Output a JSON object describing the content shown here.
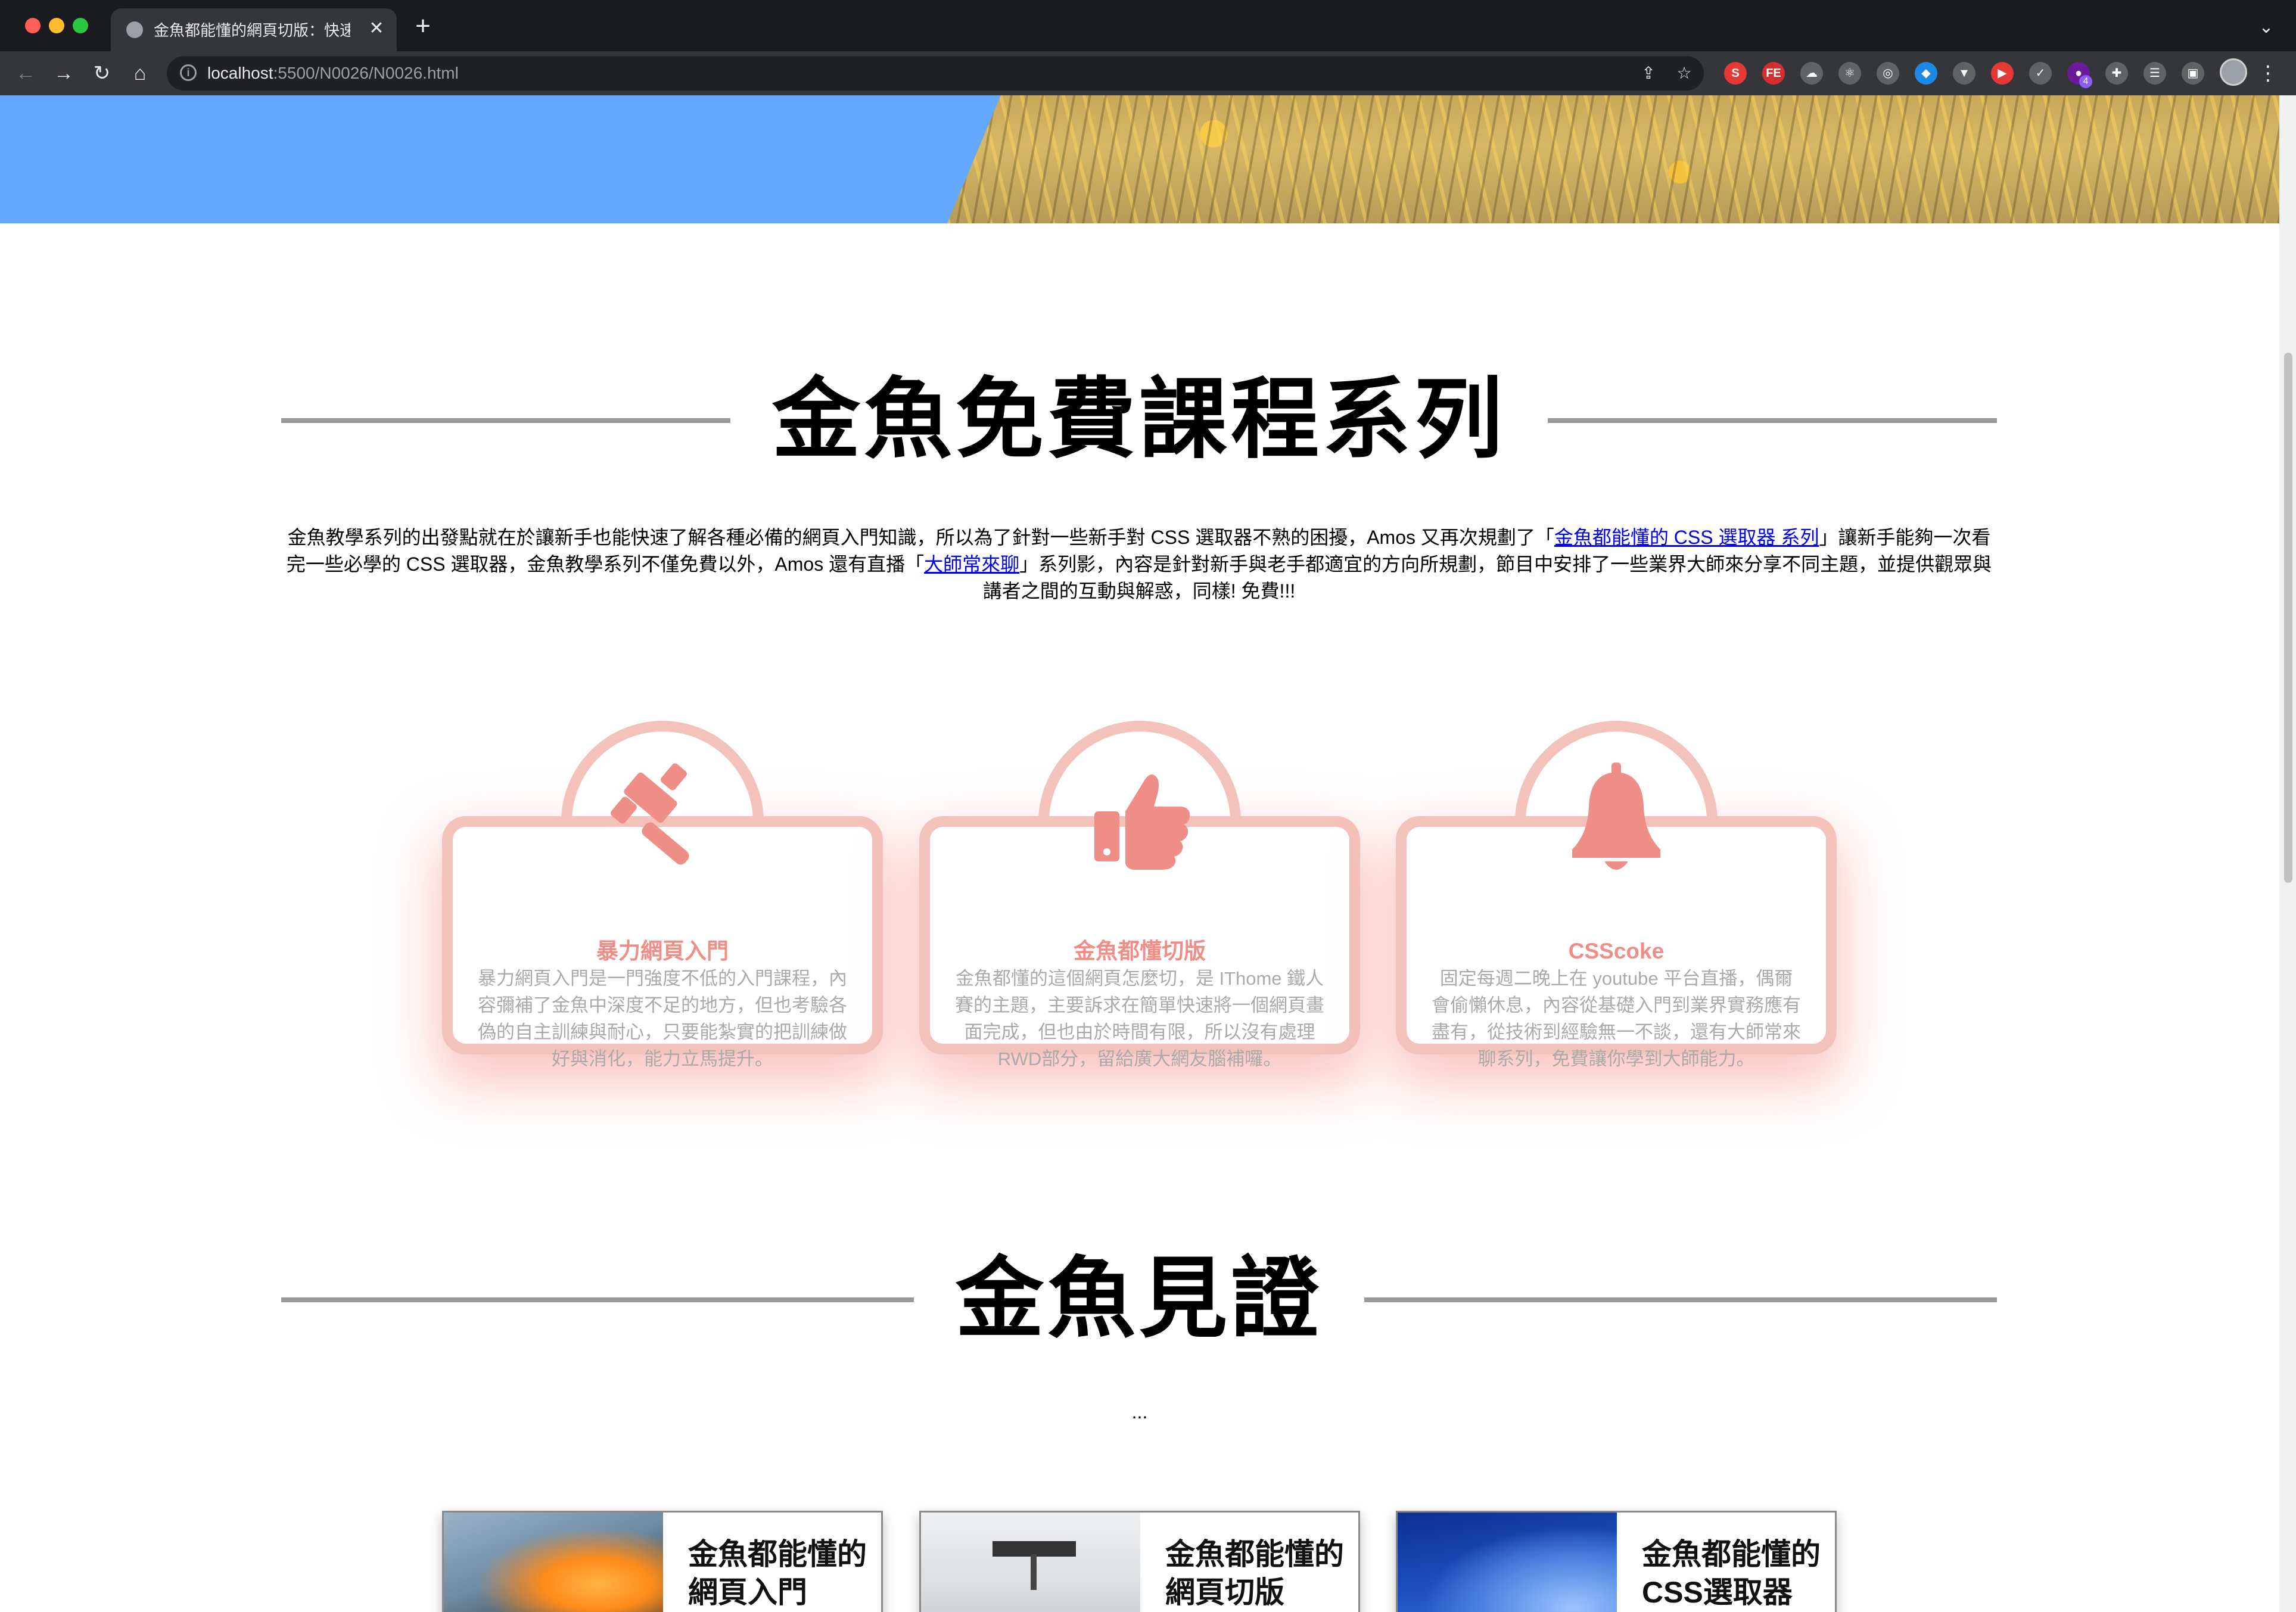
{
  "browser": {
    "tab_title": "金魚都能懂的網頁切版：快速版面",
    "tab_close": "✕",
    "new_tab": "+",
    "tab_menu": "⌄",
    "url_host": "localhost",
    "url_path": ":5500/N0026/N0026.html",
    "nav": {
      "back": "←",
      "forward": "→",
      "reload": "↻",
      "home": "⌂"
    },
    "omnibox_actions": {
      "share": "⇪",
      "bookmark": "☆"
    },
    "extensions": [
      {
        "name": "s-extension-icon",
        "glyph": "S",
        "color": "#e53935"
      },
      {
        "name": "fe-extension-icon",
        "glyph": "FE",
        "color": "#d32f2f"
      },
      {
        "name": "cloud-extension-icon",
        "glyph": "☁",
        "color": "#5f6368"
      },
      {
        "name": "react-extension-icon",
        "glyph": "⚛",
        "color": "#5f6368"
      },
      {
        "name": "target-extension-icon",
        "glyph": "◎",
        "color": "#5f6368"
      },
      {
        "name": "gem-extension-icon",
        "glyph": "◆",
        "color": "#1e88e5"
      },
      {
        "name": "vue-extension-icon",
        "glyph": "▼",
        "color": "#5f6368"
      },
      {
        "name": "play-extension-icon",
        "glyph": "▶",
        "color": "#e53935"
      },
      {
        "name": "check-extension-icon",
        "glyph": "✓",
        "color": "#5f6368"
      },
      {
        "name": "purple-extension-icon",
        "glyph": "●",
        "color": "#6a1b9a",
        "badge": "4"
      },
      {
        "name": "puzzle-extension-icon",
        "glyph": "✚",
        "color": "#5f6368"
      },
      {
        "name": "reading-list-icon",
        "glyph": "☰",
        "color": "#5f6368"
      },
      {
        "name": "side-panel-icon",
        "glyph": "▣",
        "color": "#5f6368"
      }
    ],
    "menu": "⋮"
  },
  "courses_section": {
    "heading": "金魚免費課程系列",
    "intro_part1": "金魚教學系列的出發點就在於讓新手也能快速了解各種必備的網頁入門知識，所以為了針對一些新手對 CSS 選取器不熟的困擾，Amos 又再次規劃了「",
    "intro_link1": "金魚都能懂的 CSS 選取器 系列",
    "intro_part2": "」讓新手能夠一次看完一些必學的 CSS 選取器，金魚教學系列不僅免費以外，Amos 還有直播「",
    "intro_link2": "大師常來聊",
    "intro_part3": "」系列影，內容是針對新手與老手都適宜的方向所規劃，節目中安排了一些業界大師來分享不同主題，並提供觀眾與講者之間的互動與解惑，同樣! 免費!!!"
  },
  "cards": [
    {
      "icon": "gavel-icon",
      "title": "暴力網頁入門",
      "desc": "暴力網頁入門是一門強度不低的入門課程，內容彌補了金魚中深度不足的地方，但也考驗各偽的自主訓練與耐心，只要能紮實的把訓練做好與消化，能力立馬提升。"
    },
    {
      "icon": "thumbs-up-icon",
      "title": "金魚都懂切版",
      "desc": "金魚都懂的這個網頁怎麼切，是 IThome 鐵人賽的主題，主要訴求在簡單快速將一個網頁畫面完成，但也由於時間有限，所以沒有處理RWD部分，留給廣大網友腦補囉。"
    },
    {
      "icon": "bell-icon",
      "title": "CSScoke",
      "desc": "固定每週二晚上在 youtube 平台直播，偶爾會偷懶休息，內容從基礎入門到業界實務應有盡有，從技術到經驗無一不談，還有大師常來聊系列，免費讓你學到大師能力。"
    }
  ],
  "colors": {
    "hero_blue": "#64a8ff",
    "card_border": "#f3c2ba",
    "card_icon": "#ef8d87",
    "card_desc": "#aaaaaa",
    "heading_line": "#999999"
  },
  "testimony_section": {
    "heading": "金魚見證",
    "ellipsis": "..."
  },
  "bottom_cards": [
    {
      "title_line1": "金魚都能懂的",
      "title_line2": "網頁入門",
      "photo": "orange-grass-photo"
    },
    {
      "title_line1": "金魚都能懂的",
      "title_line2": "網頁切版",
      "photo": "snow-signpost-photo"
    },
    {
      "title_line1": "金魚都能懂的",
      "title_line2": "CSS選取器",
      "photo": "blue-sky-photo"
    }
  ]
}
